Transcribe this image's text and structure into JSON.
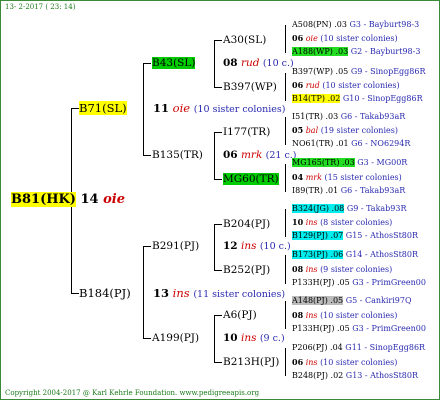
{
  "header": {
    "date_text": "13- 2-2017 ( 23: 14)"
  },
  "footer": {
    "copyright": "Copyright 2004-2017 @ Karl Kehrle Foundation.",
    "link": "www.pedigreeapis.org"
  },
  "root": {
    "name": "B81(HK)",
    "year": "14",
    "breed": "oie"
  },
  "g2": {
    "top": {
      "name": "B71(SL)",
      "year": "11",
      "breed": "oie",
      "sisters": "(10 sister colonies)"
    },
    "bottom": {
      "name": "B184(PJ)",
      "year": "13",
      "breed": "ins",
      "sisters": "(11 sister colonies)"
    }
  },
  "g3": [
    {
      "name": "B43(SL)"
    },
    {
      "name": "B135(TR)"
    },
    {
      "name": "B291(PJ)"
    },
    {
      "name": "A199(PJ)"
    }
  ],
  "g4": [
    {
      "name": "A30(SL)"
    },
    {
      "name": "08",
      "breed": "rud",
      "sisters": "(10 c.)"
    },
    {
      "name": "B397(WP)"
    },
    {
      "name": "I177(TR)"
    },
    {
      "name": "06",
      "breed": "mrk",
      "sisters": "(21 c.)"
    },
    {
      "name": "MG60(TR)"
    },
    {
      "name": "B204(PJ)"
    },
    {
      "name": "12",
      "breed": "ins",
      "sisters": "(10 c.)"
    },
    {
      "name": "B252(PJ)"
    },
    {
      "name": "A6(PJ)"
    },
    {
      "name": "10",
      "breed": "ins",
      "sisters": "(9 c.)"
    },
    {
      "name": "B213H(PJ)"
    }
  ],
  "g5": [
    {
      "left": "A508(PN) .03",
      "right": "G3 - Bayburt98-3"
    },
    {
      "left": "06",
      "breed": "oie",
      "sisters": "(10 sister colonies)"
    },
    {
      "left": "A188(WP) .03",
      "right": "G2 - Bayburt98-3"
    },
    {
      "left": "B397(WP) .05",
      "right": "G9 - SinopEgg86R"
    },
    {
      "left": "06",
      "breed": "rud",
      "sisters": "(10 sister colonies)"
    },
    {
      "left": "B14(TP) .02",
      "right": "G10 - SinopEgg86R"
    },
    {
      "left": "I51(TR) .03",
      "right": "G6 - Takab93aR"
    },
    {
      "left": "05",
      "breed": "bal",
      "sisters": "(19 sister colonies)"
    },
    {
      "left": "NO61(TR) .01",
      "right": "G6 - NO6294R"
    },
    {
      "left": "MG165(TR) .03",
      "right": "G3 - MG00R"
    },
    {
      "left": "04",
      "breed": "mrk",
      "sisters": "(15 sister colonies)"
    },
    {
      "left": "I89(TR) .01",
      "right": "G6 - Takab93aR"
    },
    {
      "left": "B324(JG) .08",
      "right": "G9 - Takab93R"
    },
    {
      "left": "10",
      "breed": "ins",
      "sisters": "(8 sister colonies)"
    },
    {
      "left": "B129(PJ) .07",
      "right": "G15 - AthosSt80R"
    },
    {
      "left": "B173(PJ) .06",
      "right": "G14 - AthosSt80R"
    },
    {
      "left": "08",
      "breed": "ins",
      "sisters": "(9 sister colonies)"
    },
    {
      "left": "P133H(PJ) .05",
      "right": "G3 - PrimGreen00"
    },
    {
      "left": "A148(PJ) .05",
      "right": "G5 - Cankiri97Q"
    },
    {
      "left": "08",
      "breed": "ins",
      "sisters": "(10 sister colonies)"
    },
    {
      "left": "P133H(PJ) .05",
      "right": "G3 - PrimGreen00"
    },
    {
      "left": "P206(PJ) .04",
      "right": "G11 - SinopEgg86R"
    },
    {
      "left": "06",
      "breed": "ins",
      "sisters": "(10 sister colonies)"
    },
    {
      "left": "B248(PJ) .02",
      "right": "G13 - AthosSt80R"
    }
  ]
}
